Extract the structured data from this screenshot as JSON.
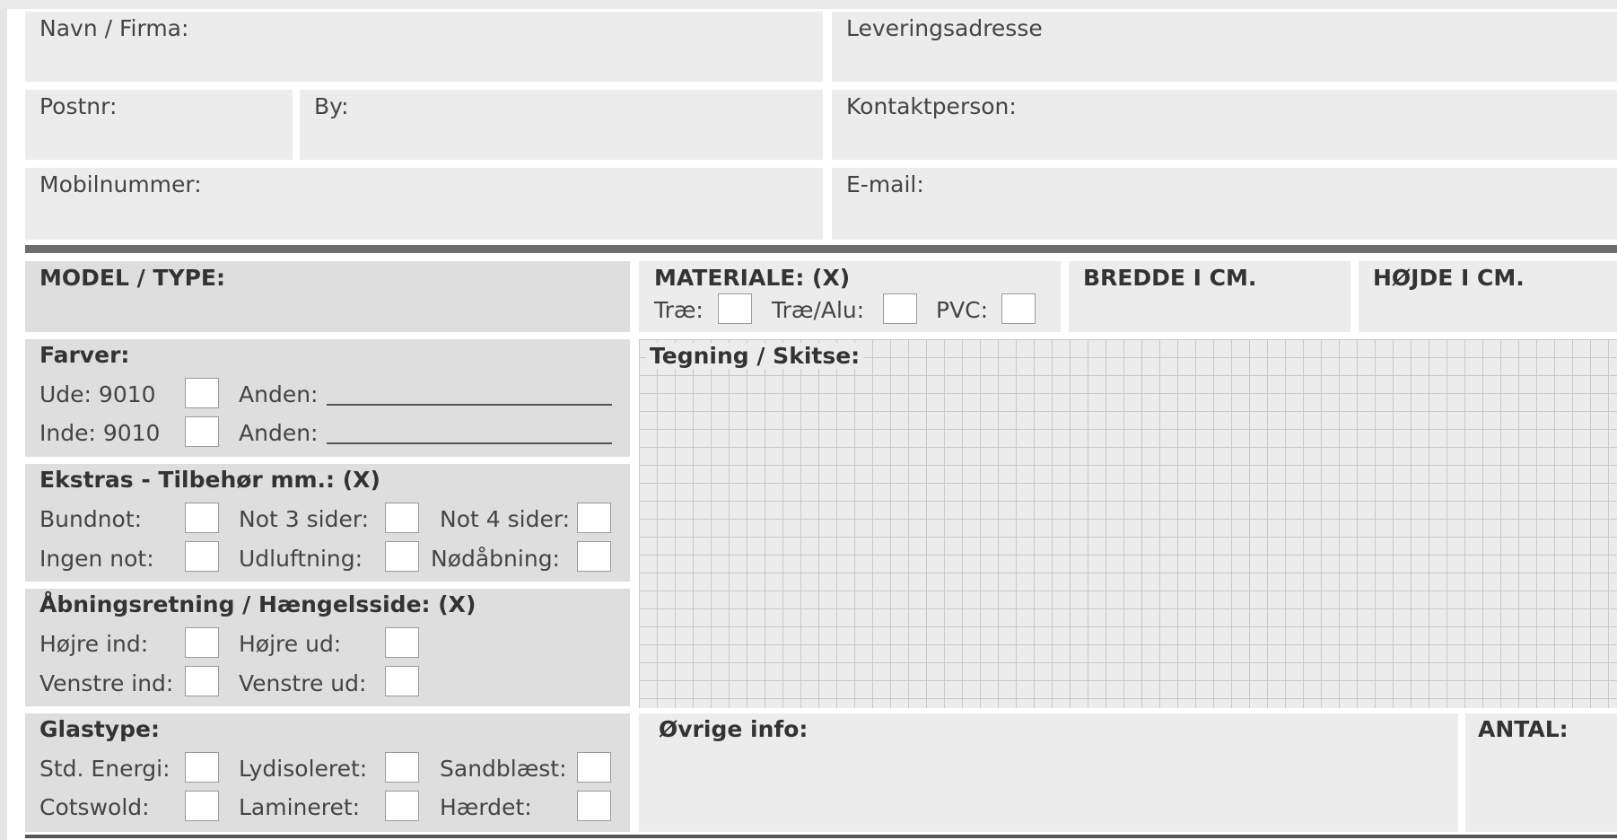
{
  "customer": {
    "name_label": "Navn / Firma:",
    "delivery_label": "Leveringsadresse",
    "postnr_label": "Postnr:",
    "by_label": "By:",
    "contact_label": "Kontaktperson:",
    "mobile_label": "Mobilnummer:",
    "email_label": "E-mail:"
  },
  "model": {
    "label": "MODEL / TYPE:"
  },
  "material": {
    "title": "MATERIALE: (X)",
    "opt_trae": "Træ:",
    "opt_traealu": "Træ/Alu:",
    "opt_pvc": "PVC:"
  },
  "width": {
    "label": "BREDDE I CM."
  },
  "height": {
    "label": "HØJDE I CM."
  },
  "colors": {
    "title": "Farver:",
    "ude": "Ude: 9010",
    "inde": "Inde: 9010",
    "anden1": "Anden:",
    "anden2": "Anden:"
  },
  "extras": {
    "title": "Ekstras - Tilbehør mm.: (X)",
    "bundnot": "Bundnot:",
    "not3": "Not 3 sider:",
    "not4": "Not 4 sider:",
    "ingennot": "Ingen not:",
    "udluftning": "Udluftning:",
    "nodabning": "Nødåbning:"
  },
  "opening": {
    "title": "Åbningsretning / Hængelsside: (X)",
    "hojre_ind": "Højre ind:",
    "hojre_ud": "Højre ud:",
    "venstre_ind": "Venstre ind:",
    "venstre_ud": "Venstre ud:"
  },
  "glass": {
    "title": "Glastype:",
    "std": "Std. Energi:",
    "lyd": "Lydisoleret:",
    "sand": "Sandblæst:",
    "cots": "Cotswold:",
    "lam": "Lamineret:",
    "haerdet": "Hærdet:"
  },
  "drawing": {
    "label": "Tegning / Skitse:"
  },
  "other": {
    "label": "Øvrige info:"
  },
  "quantity": {
    "label": "ANTAL:"
  }
}
